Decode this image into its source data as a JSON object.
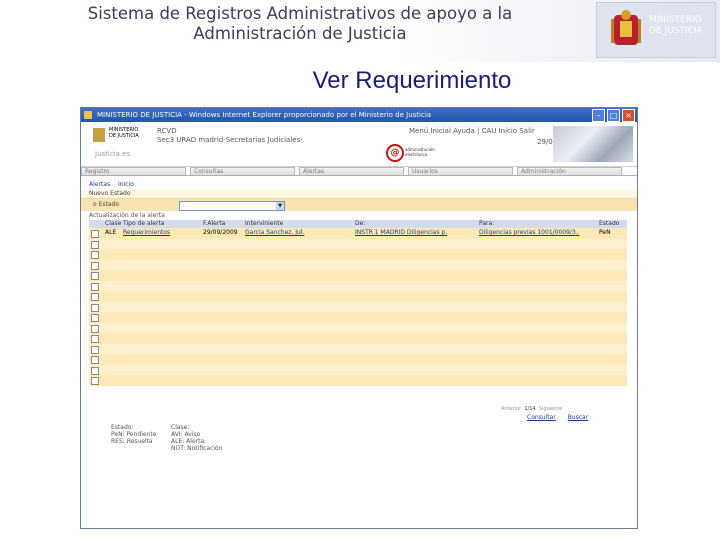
{
  "slide": {
    "title_line1": "Sistema de Registros Administrativos de apoyo a la",
    "title_line2": "Administración de Justicia",
    "heading": "Ver Requerimiento",
    "logo_line1": "MINISTERIO",
    "logo_line2": "DE JUSTICIA"
  },
  "window": {
    "title": "MINISTERIO DE JUSTICIA - Windows Internet Explorer proporcionado por el Ministerio de Justicia",
    "app_ministry_line1": "MINISTERIO",
    "app_ministry_line2": "DE JUSTICIA",
    "justicia_es": "Justicia.es",
    "app_name": "RCVD",
    "app_sub": "Sec3 URAD madrid-Secretarias Judiciales-",
    "at_text_line1": "administración",
    "at_text_line2": "electrónica",
    "top_menu": "Menú Inicial  Ayuda | CAU  Inicio  Salir",
    "top_date": "29/09/2009",
    "tabs": [
      "Registro",
      "Consultas",
      "Alertas",
      "Usuarios",
      "Administración"
    ],
    "crumbs": [
      "Alertas",
      "Inicio"
    ],
    "section_estado": "Nuevo Estado",
    "filter_label": "o Estado",
    "section_alerta": "Actualización de la alerta",
    "columns": [
      "Clase",
      "Tipo de alerta",
      "F.Alerta",
      "Interviniente",
      "De:",
      "Para:",
      "Estado"
    ],
    "rows": [
      {
        "clase": "ALE",
        "tipo": "Requerimientos",
        "fecha": "29/09/2009",
        "interviniente": "Garcia Sanchez, Jul.",
        "de": "INSTR 1 MADRID Diligencias p.",
        "para": "Diligencias previas 1001/0009/3..",
        "estado": "PeN"
      }
    ],
    "empty_rows": 14,
    "pager_prev": "Anterior",
    "pager_count": "1/14",
    "pager_next": "Siguiente",
    "action_consultar": "Consultar",
    "action_buscar": "Buscar",
    "legend_estado_title": "Estado:",
    "legend_estado_items": [
      "PeN: Pendiente",
      "RES: Resuelta"
    ],
    "legend_clase_title": "Clase:",
    "legend_clase_items": [
      "AVI: Aviso",
      "ALE: Alerta",
      "NOT: Notificación"
    ]
  },
  "colors": {
    "title_text": "#3a3d5c",
    "heading": "#1c1c78",
    "ie_titlebar": "#2255a8",
    "grid_row": "#fde8b8"
  }
}
